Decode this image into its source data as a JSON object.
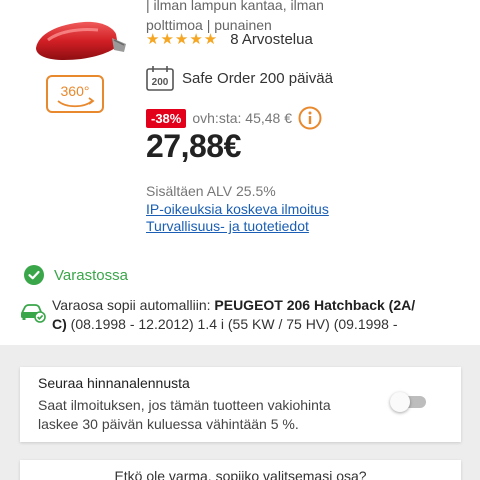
{
  "product": {
    "subtitle_line1": "| ilman lampun kantaa, ilman",
    "subtitle_line2": "polttimoa | punainen",
    "image_icon": "red-tail-light-product-image",
    "view_360_label": "360°"
  },
  "rating": {
    "stars": "★★★★★",
    "text": "8 Arvostelua",
    "star_color": "#f5a623"
  },
  "safe_order": {
    "icon_label": "200",
    "text": "Safe Order 200 päivää"
  },
  "price": {
    "discount": "-38%",
    "rrp": "ovh:sta: 45,48 €",
    "current": "27,88€",
    "discount_color": "#e2001a",
    "info_icon_color": "#e8892e"
  },
  "vat_text": "Sisältäen ALV 25.5%",
  "links": {
    "ip_rights": "IP-oikeuksia koskeva ilmoitus",
    "safety_info": "Turvallisuus- ja tuotetiedot"
  },
  "stock": {
    "text": "Varastossa",
    "color": "#3aa64a"
  },
  "compatibility": {
    "prefix": "Varaosa sopii automalliin: ",
    "model_bold": "PEUGEOT 206 Hatchback (2A/",
    "line2_bold": "C)",
    "line2_rest": " (08.1998 - 12.2012) 1.4 i (55 KW / 75 HV) (09.1998 -"
  },
  "price_alert": {
    "title": "Seuraa hinnanalennusta",
    "description": "Saat ilmoituksen, jos tämän tuotteen vakiohinta laskee 30 päivän kuluessa vähintään 5 %.",
    "toggle_on": false
  },
  "fit_check": {
    "text": "Etkö ole varma, sopiiko valitsemasi osa?"
  }
}
